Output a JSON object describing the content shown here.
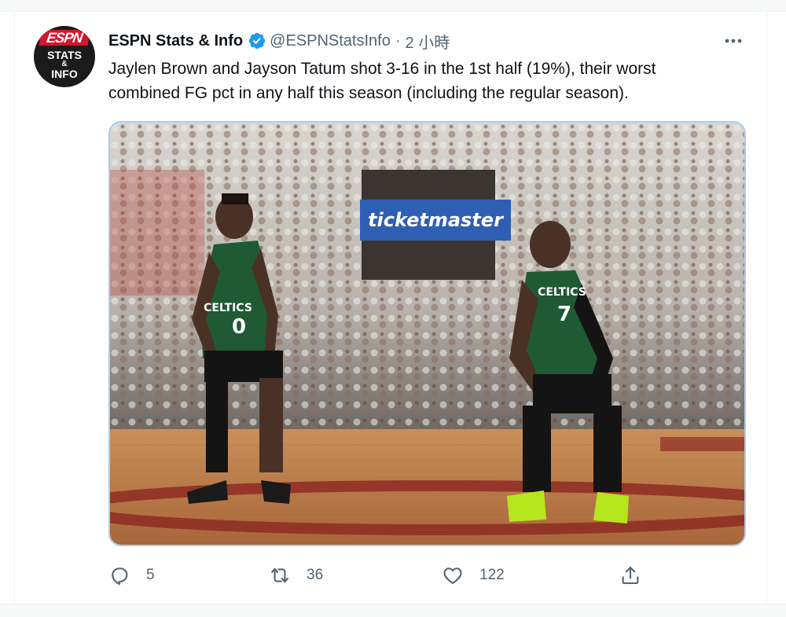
{
  "tweet": {
    "author_name": "ESPN Stats & Info",
    "author_handle": "@ESPNStatsInfo",
    "separator": "·",
    "time": "2 小時",
    "text_line1": "Jaylen Brown and Jayson Tatum shot 3-16 in the 1st half (19%), their worst",
    "text_line2": "combined FG pct in any half this season (including the regular season).",
    "avatar": {
      "logo": "ESPN",
      "line1": "STATS",
      "line2": "&",
      "line3": "INFO"
    },
    "image_banner": "ticketmaster",
    "jersey_left": "0",
    "jersey_right": "7",
    "team_text": "CELTICS"
  },
  "actions": {
    "reply_count": "5",
    "retweet_count": "36",
    "like_count": "122"
  },
  "icons": [
    "verified-badge-icon",
    "more-icon",
    "reply-icon",
    "retweet-icon",
    "like-icon",
    "share-icon"
  ],
  "colors": {
    "accent": "#1d9bf0",
    "muted": "#536471",
    "text": "#0f1419",
    "media_border": "#a8cdf2"
  }
}
